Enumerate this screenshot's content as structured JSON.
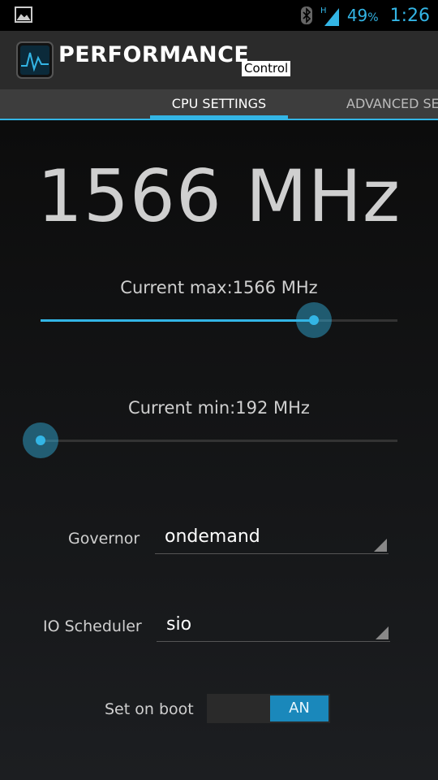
{
  "status_bar": {
    "notification_icon": "image-icon",
    "bluetooth_icon": "bluetooth-icon",
    "network_type": "H",
    "battery_percent": "49",
    "battery_unit": "%",
    "time": "1:26"
  },
  "app": {
    "title": "PERFORMANCE",
    "subtitle": "Control",
    "logo_icon": "pulse-monitor-icon"
  },
  "tabs": [
    {
      "label": "CPU SETTINGS",
      "selected": true
    },
    {
      "label": "ADVANCED SE",
      "selected": false
    }
  ],
  "cpu": {
    "current_frequency": "1566 MHz",
    "max_label": "Current max:1566 MHz",
    "max_slider_fraction": 0.766,
    "min_label": "Current min:192 MHz",
    "min_slider_fraction": 0.0
  },
  "governor": {
    "label": "Governor",
    "value": "ondemand"
  },
  "io_scheduler": {
    "label": "IO Scheduler",
    "value": "sio"
  },
  "set_on_boot": {
    "label": "Set on boot",
    "toggle_text": "AN",
    "on": true
  },
  "colors": {
    "accent": "#33b5e5",
    "toggle_on": "#1a88bb"
  }
}
